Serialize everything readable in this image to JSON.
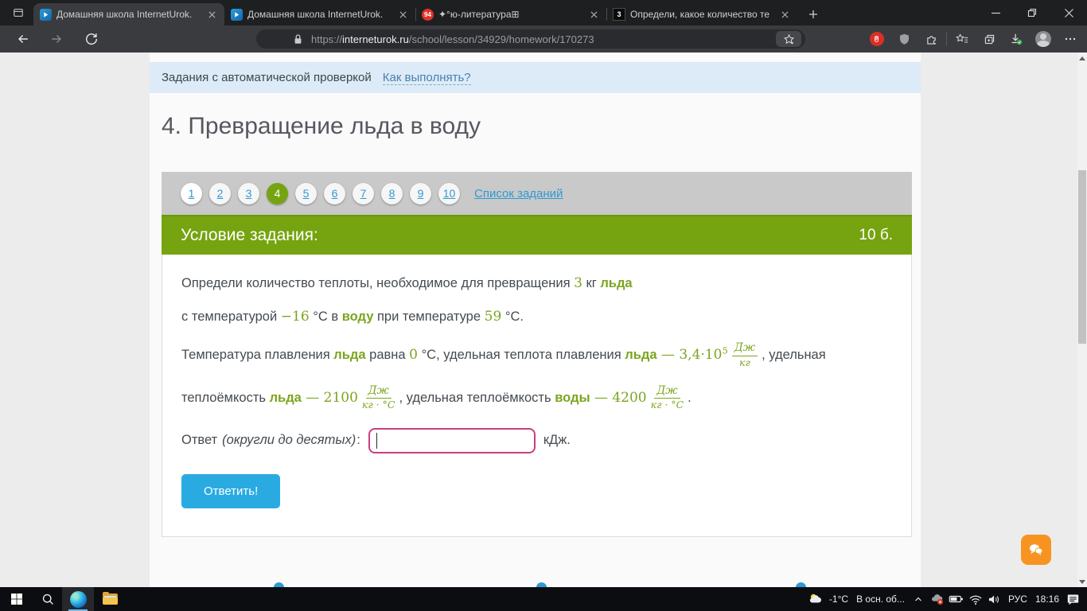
{
  "colors": {
    "green": "#76a410",
    "mathgreen": "#7ba51d",
    "termgreen": "#7ba51d",
    "link": "#2e9ad2",
    "banner-link": "#4a7fae",
    "btn": "#29abe2",
    "pink": "#c84080",
    "chat": "#f79421"
  },
  "browser": {
    "tabs": [
      {
        "title": "Домашняя школа InternetUrok.",
        "favicon": "interneturok"
      },
      {
        "title": "Домашняя школа InternetUrok.",
        "favicon": "interneturok"
      },
      {
        "title": "✦°ю-литература⊞",
        "favicon_text": "94"
      },
      {
        "title": "Определи, какое количество те",
        "favicon_text": "3"
      }
    ],
    "address": {
      "scheme": "https://",
      "domain": "interneturok.ru",
      "path": "/school/lesson/34929/homework/170273"
    }
  },
  "page": {
    "banner": {
      "text": "Задания с автоматической проверкой",
      "link": "Как выполнять?"
    },
    "title": "4. Превращение льда в воду",
    "pagination": {
      "items": [
        "1",
        "2",
        "3",
        "4",
        "5",
        "6",
        "7",
        "8",
        "9",
        "10"
      ],
      "active_index": 3,
      "list_link": "Список заданий"
    },
    "task_header": {
      "label": "Условие задания:",
      "points": "10 б."
    },
    "problem_paragraphs": [
      [
        {
          "t": "text",
          "v": "Определи количество теплоты, необходимое для превращения "
        },
        {
          "t": "math",
          "v": "3"
        },
        {
          "t": "text",
          "v": " кг "
        },
        {
          "t": "term",
          "v": "льда"
        }
      ],
      [
        {
          "t": "text",
          "v": "с температурой "
        },
        {
          "t": "math",
          "v": "−16"
        },
        {
          "t": "text",
          "v": " °C в "
        },
        {
          "t": "term",
          "v": "воду"
        },
        {
          "t": "text",
          "v": " при температуре "
        },
        {
          "t": "math",
          "v": "59"
        },
        {
          "t": "text",
          "v": " °C."
        }
      ],
      [
        {
          "t": "text",
          "v": "Температура плавления "
        },
        {
          "t": "term",
          "v": "льда"
        },
        {
          "t": "text",
          "v": " равна "
        },
        {
          "t": "math",
          "v": "0"
        },
        {
          "t": "text",
          "v": " °C, удельная теплота плавления "
        },
        {
          "t": "term",
          "v": "льда"
        },
        {
          "t": "math",
          "v": " — 3,4·10"
        },
        {
          "t": "sup",
          "v": "5"
        },
        {
          "t": "frac",
          "num": "Дж",
          "den": "кг"
        },
        {
          "t": "text",
          "v": ", удельная"
        }
      ],
      [
        {
          "t": "text",
          "v": "теплоёмкость "
        },
        {
          "t": "term",
          "v": "льда"
        },
        {
          "t": "math",
          "v": " — 2100"
        },
        {
          "t": "frac",
          "num": "Дж",
          "den": "кг · °C"
        },
        {
          "t": "text",
          "v": ", удельная теплоёмкость "
        },
        {
          "t": "term",
          "v": "воды"
        },
        {
          "t": "math",
          "v": " — 4200"
        },
        {
          "t": "frac",
          "num": "Дж",
          "den": "кг · °C"
        },
        {
          "t": "text",
          "v": "."
        }
      ]
    ],
    "answer": {
      "label": "Ответ",
      "hint": "(округли до десятых)",
      "colon": ":",
      "input_value": "",
      "unit": "кДж."
    },
    "submit_label": "Ответить!"
  },
  "taskbar": {
    "temperature": "-1°C",
    "weather_label": "В осн. об...",
    "language": "РУС",
    "time": "18:16"
  }
}
